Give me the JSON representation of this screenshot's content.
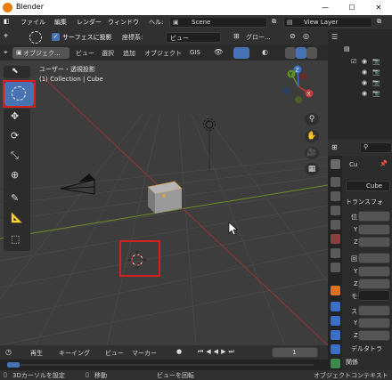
{
  "window": {
    "title": "Blender",
    "minimize": "—",
    "maximize": "☐",
    "close": "✕"
  },
  "menu": {
    "file": "ファイル",
    "edit": "編集",
    "render": "レンダー",
    "window": "ウィンドウ",
    "help": "ヘル:",
    "scene": "Scene",
    "view_layer": "View Layer"
  },
  "header": {
    "surface_project": "サーフェスに投影",
    "coordinate_label": "座標系:",
    "coordinate_value": "ビュー",
    "transform_value": "グロー..."
  },
  "header2": {
    "object_mode": "オブジェク...",
    "view": "ビュー",
    "select": "選択",
    "add": "追加",
    "object": "オブジェクト",
    "gis": "GIS"
  },
  "viewport": {
    "view_name": "ユーザー・透視投影",
    "collection_info": "(1) Collection | Cube"
  },
  "gizmo": {
    "x": "X",
    "y": "Y",
    "z": "Z"
  },
  "timeline": {
    "playback": "再生",
    "keying": "キーイング",
    "view": "ビュー",
    "marker": "マーカー",
    "current_frame": "1"
  },
  "status": {
    "cursor": "3Dカーソルを設定",
    "move": "移動",
    "rotate_view": "ビューを回転",
    "context": "オブジェクトコンテキスト"
  },
  "properties": {
    "search_placeholder": "",
    "object_short": "Cu",
    "object_name": "Cube",
    "transform_section": "トランスフォ",
    "pos_label": "位",
    "y1": "Y",
    "z1": "Z",
    "rot_label": "回",
    "y2": "Y",
    "z2": "Z",
    "mode_label": "モ",
    "scale_label": "ス",
    "y3": "Y",
    "z3": "Z",
    "delta": "デルタトラ",
    "relations": "関係"
  },
  "colors": {
    "accent_blue": "#4772b3",
    "highlight_red": "#d62020",
    "x_axis": "#c73a3a",
    "y_axis": "#5f8f1f",
    "brand_orange": "#e87d0d"
  }
}
